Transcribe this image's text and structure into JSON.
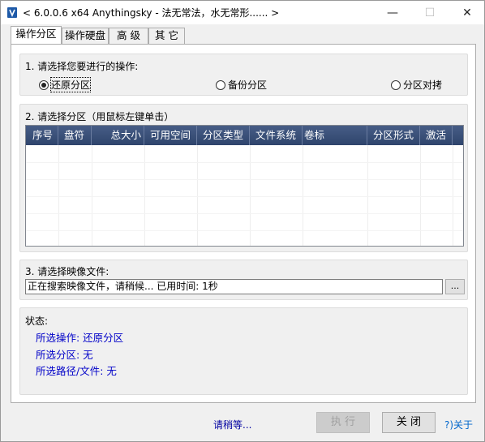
{
  "window": {
    "title": "< 6.0.0.6 x64 Anythingsky - 法无常法，水无常形...... >",
    "min_symbol": "—",
    "max_symbol": "☐",
    "close_symbol": "✕"
  },
  "tabs": [
    {
      "label": "操作分区",
      "active": true
    },
    {
      "label": "操作硬盘",
      "active": false
    },
    {
      "label": "高 级",
      "active": false
    },
    {
      "label": "其 它",
      "active": false
    }
  ],
  "section1": {
    "label": "1. 请选择您要进行的操作:",
    "options": [
      {
        "label": "还原分区",
        "checked": true
      },
      {
        "label": "备份分区",
        "checked": false
      },
      {
        "label": "分区对拷",
        "checked": false
      }
    ]
  },
  "section2": {
    "label": "2. 请选择分区（用鼠标左键单击）",
    "columns": [
      "序号",
      "盘符",
      "总大小",
      "可用空间",
      "分区类型",
      "文件系统",
      "卷标",
      "分区形式",
      "激活"
    ]
  },
  "section3": {
    "label": "3. 请选择映像文件:",
    "path_value": "正在搜索映像文件，请稍候...    已用时间: 1秒",
    "browse_label": "..."
  },
  "status": {
    "label": "状态:",
    "operation": "所选操作: 还原分区",
    "partition": "所选分区: 无",
    "path": "所选路径/文件: 无"
  },
  "footer": {
    "wait_text": "请稍等...",
    "execute_label": "执 行",
    "close_label": "关 闭",
    "about_label": "?)关于"
  }
}
